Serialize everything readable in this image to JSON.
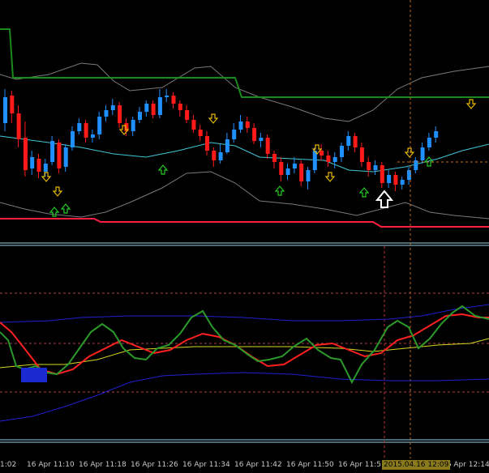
{
  "colors": {
    "background": "#000000",
    "bull_candle": "#1e90ff",
    "bear_candle": "#ff1a1a",
    "bb_mid": "#40c8d8",
    "bb_outer": "#7a7a7a",
    "trail_stop_upper": "#1a8a1a",
    "trail_stop_lower": "#ff2040",
    "signal_up": "#22cc22",
    "signal_down": "#e6b800",
    "panel_separator": "#8fd0e6",
    "osc_green": "#2a9a2a",
    "osc_red": "#ff2020",
    "osc_yellow": "#d8d820",
    "osc_blue": "#2020d0",
    "level_dotted": "#b04040",
    "crosshair": "#c06a20"
  },
  "icons": {
    "up_arrow": "up-arrow-icon",
    "down_arrow": "down-arrow-icon",
    "cursor_arrow": "big-up-arrow-cursor-icon"
  },
  "time_axis": {
    "labels": [
      "1:02",
      "16 Apr 11:10",
      "16 Apr 11:18",
      "16 Apr 11:26",
      "16 Apr 11:34",
      "16 Apr 11:42",
      "16 Apr 11:50",
      "16 Apr 11:5",
      "16 Apr 12:14"
    ],
    "crosshair_time": "2015.04.16 12:09"
  },
  "candles": [
    {
      "o": 62,
      "c": 30,
      "h": 20,
      "l": 72
    },
    {
      "o": 28,
      "c": 50,
      "h": 22,
      "l": 62
    },
    {
      "o": 50,
      "c": 82,
      "h": 40,
      "l": 92
    },
    {
      "o": 80,
      "c": 120,
      "h": 60,
      "l": 128
    },
    {
      "o": 118,
      "c": 104,
      "h": 96,
      "l": 126
    },
    {
      "o": 106,
      "c": 122,
      "h": 100,
      "l": 130
    },
    {
      "o": 122,
      "c": 112,
      "h": 106,
      "l": 128
    },
    {
      "o": 110,
      "c": 84,
      "h": 78,
      "l": 114
    },
    {
      "o": 86,
      "c": 118,
      "h": 82,
      "l": 124
    },
    {
      "o": 116,
      "c": 92,
      "h": 88,
      "l": 122
    },
    {
      "o": 92,
      "c": 72,
      "h": 66,
      "l": 96
    },
    {
      "o": 72,
      "c": 62,
      "h": 56,
      "l": 76
    },
    {
      "o": 62,
      "c": 80,
      "h": 58,
      "l": 86
    },
    {
      "o": 80,
      "c": 76,
      "h": 70,
      "l": 86
    },
    {
      "o": 76,
      "c": 54,
      "h": 48,
      "l": 82
    },
    {
      "o": 54,
      "c": 46,
      "h": 40,
      "l": 60
    },
    {
      "o": 46,
      "c": 40,
      "h": 32,
      "l": 52
    },
    {
      "o": 40,
      "c": 62,
      "h": 36,
      "l": 68
    },
    {
      "o": 62,
      "c": 72,
      "h": 56,
      "l": 78
    },
    {
      "o": 72,
      "c": 58,
      "h": 54,
      "l": 78
    },
    {
      "o": 58,
      "c": 48,
      "h": 42,
      "l": 62
    },
    {
      "o": 48,
      "c": 38,
      "h": 34,
      "l": 54
    },
    {
      "o": 38,
      "c": 52,
      "h": 34,
      "l": 56
    },
    {
      "o": 52,
      "c": 30,
      "h": 20,
      "l": 56
    },
    {
      "o": 30,
      "c": 28,
      "h": 20,
      "l": 36
    },
    {
      "o": 28,
      "c": 38,
      "h": 24,
      "l": 44
    },
    {
      "o": 38,
      "c": 46,
      "h": 34,
      "l": 54
    },
    {
      "o": 46,
      "c": 58,
      "h": 40,
      "l": 62
    },
    {
      "o": 58,
      "c": 70,
      "h": 52,
      "l": 74
    },
    {
      "o": 70,
      "c": 78,
      "h": 64,
      "l": 84
    },
    {
      "o": 78,
      "c": 96,
      "h": 72,
      "l": 102
    },
    {
      "o": 96,
      "c": 108,
      "h": 92,
      "l": 116
    },
    {
      "o": 108,
      "c": 98,
      "h": 88,
      "l": 112
    },
    {
      "o": 98,
      "c": 82,
      "h": 74,
      "l": 100
    },
    {
      "o": 82,
      "c": 70,
      "h": 62,
      "l": 86
    },
    {
      "o": 70,
      "c": 60,
      "h": 52,
      "l": 74
    },
    {
      "o": 60,
      "c": 68,
      "h": 54,
      "l": 74
    },
    {
      "o": 68,
      "c": 84,
      "h": 62,
      "l": 88
    },
    {
      "o": 84,
      "c": 80,
      "h": 74,
      "l": 92
    },
    {
      "o": 80,
      "c": 100,
      "h": 76,
      "l": 106
    },
    {
      "o": 100,
      "c": 110,
      "h": 96,
      "l": 118
    },
    {
      "o": 110,
      "c": 126,
      "h": 104,
      "l": 134
    },
    {
      "o": 126,
      "c": 118,
      "h": 112,
      "l": 132
    },
    {
      "o": 118,
      "c": 112,
      "h": 104,
      "l": 124
    },
    {
      "o": 112,
      "c": 134,
      "h": 108,
      "l": 140
    },
    {
      "o": 134,
      "c": 120,
      "h": 116,
      "l": 144
    },
    {
      "o": 120,
      "c": 96,
      "h": 92,
      "l": 124
    },
    {
      "o": 96,
      "c": 102,
      "h": 88,
      "l": 108
    },
    {
      "o": 102,
      "c": 110,
      "h": 96,
      "l": 116
    },
    {
      "o": 110,
      "c": 104,
      "h": 98,
      "l": 118
    },
    {
      "o": 104,
      "c": 90,
      "h": 86,
      "l": 110
    },
    {
      "o": 90,
      "c": 78,
      "h": 72,
      "l": 96
    },
    {
      "o": 78,
      "c": 92,
      "h": 74,
      "l": 98
    },
    {
      "o": 92,
      "c": 110,
      "h": 86,
      "l": 116
    },
    {
      "o": 110,
      "c": 120,
      "h": 104,
      "l": 128
    },
    {
      "o": 120,
      "c": 114,
      "h": 108,
      "l": 126
    },
    {
      "o": 114,
      "c": 136,
      "h": 110,
      "l": 142
    },
    {
      "o": 136,
      "c": 126,
      "h": 120,
      "l": 142
    },
    {
      "o": 126,
      "c": 138,
      "h": 122,
      "l": 146
    },
    {
      "o": 138,
      "c": 132,
      "h": 128,
      "l": 144
    },
    {
      "o": 132,
      "c": 120,
      "h": 116,
      "l": 138
    },
    {
      "o": 120,
      "c": 108,
      "h": 104,
      "l": 124
    },
    {
      "o": 108,
      "c": 92,
      "h": 86,
      "l": 112
    },
    {
      "o": 92,
      "c": 80,
      "h": 74,
      "l": 96
    },
    {
      "o": 80,
      "c": 72,
      "h": 66,
      "l": 86
    }
  ]
}
